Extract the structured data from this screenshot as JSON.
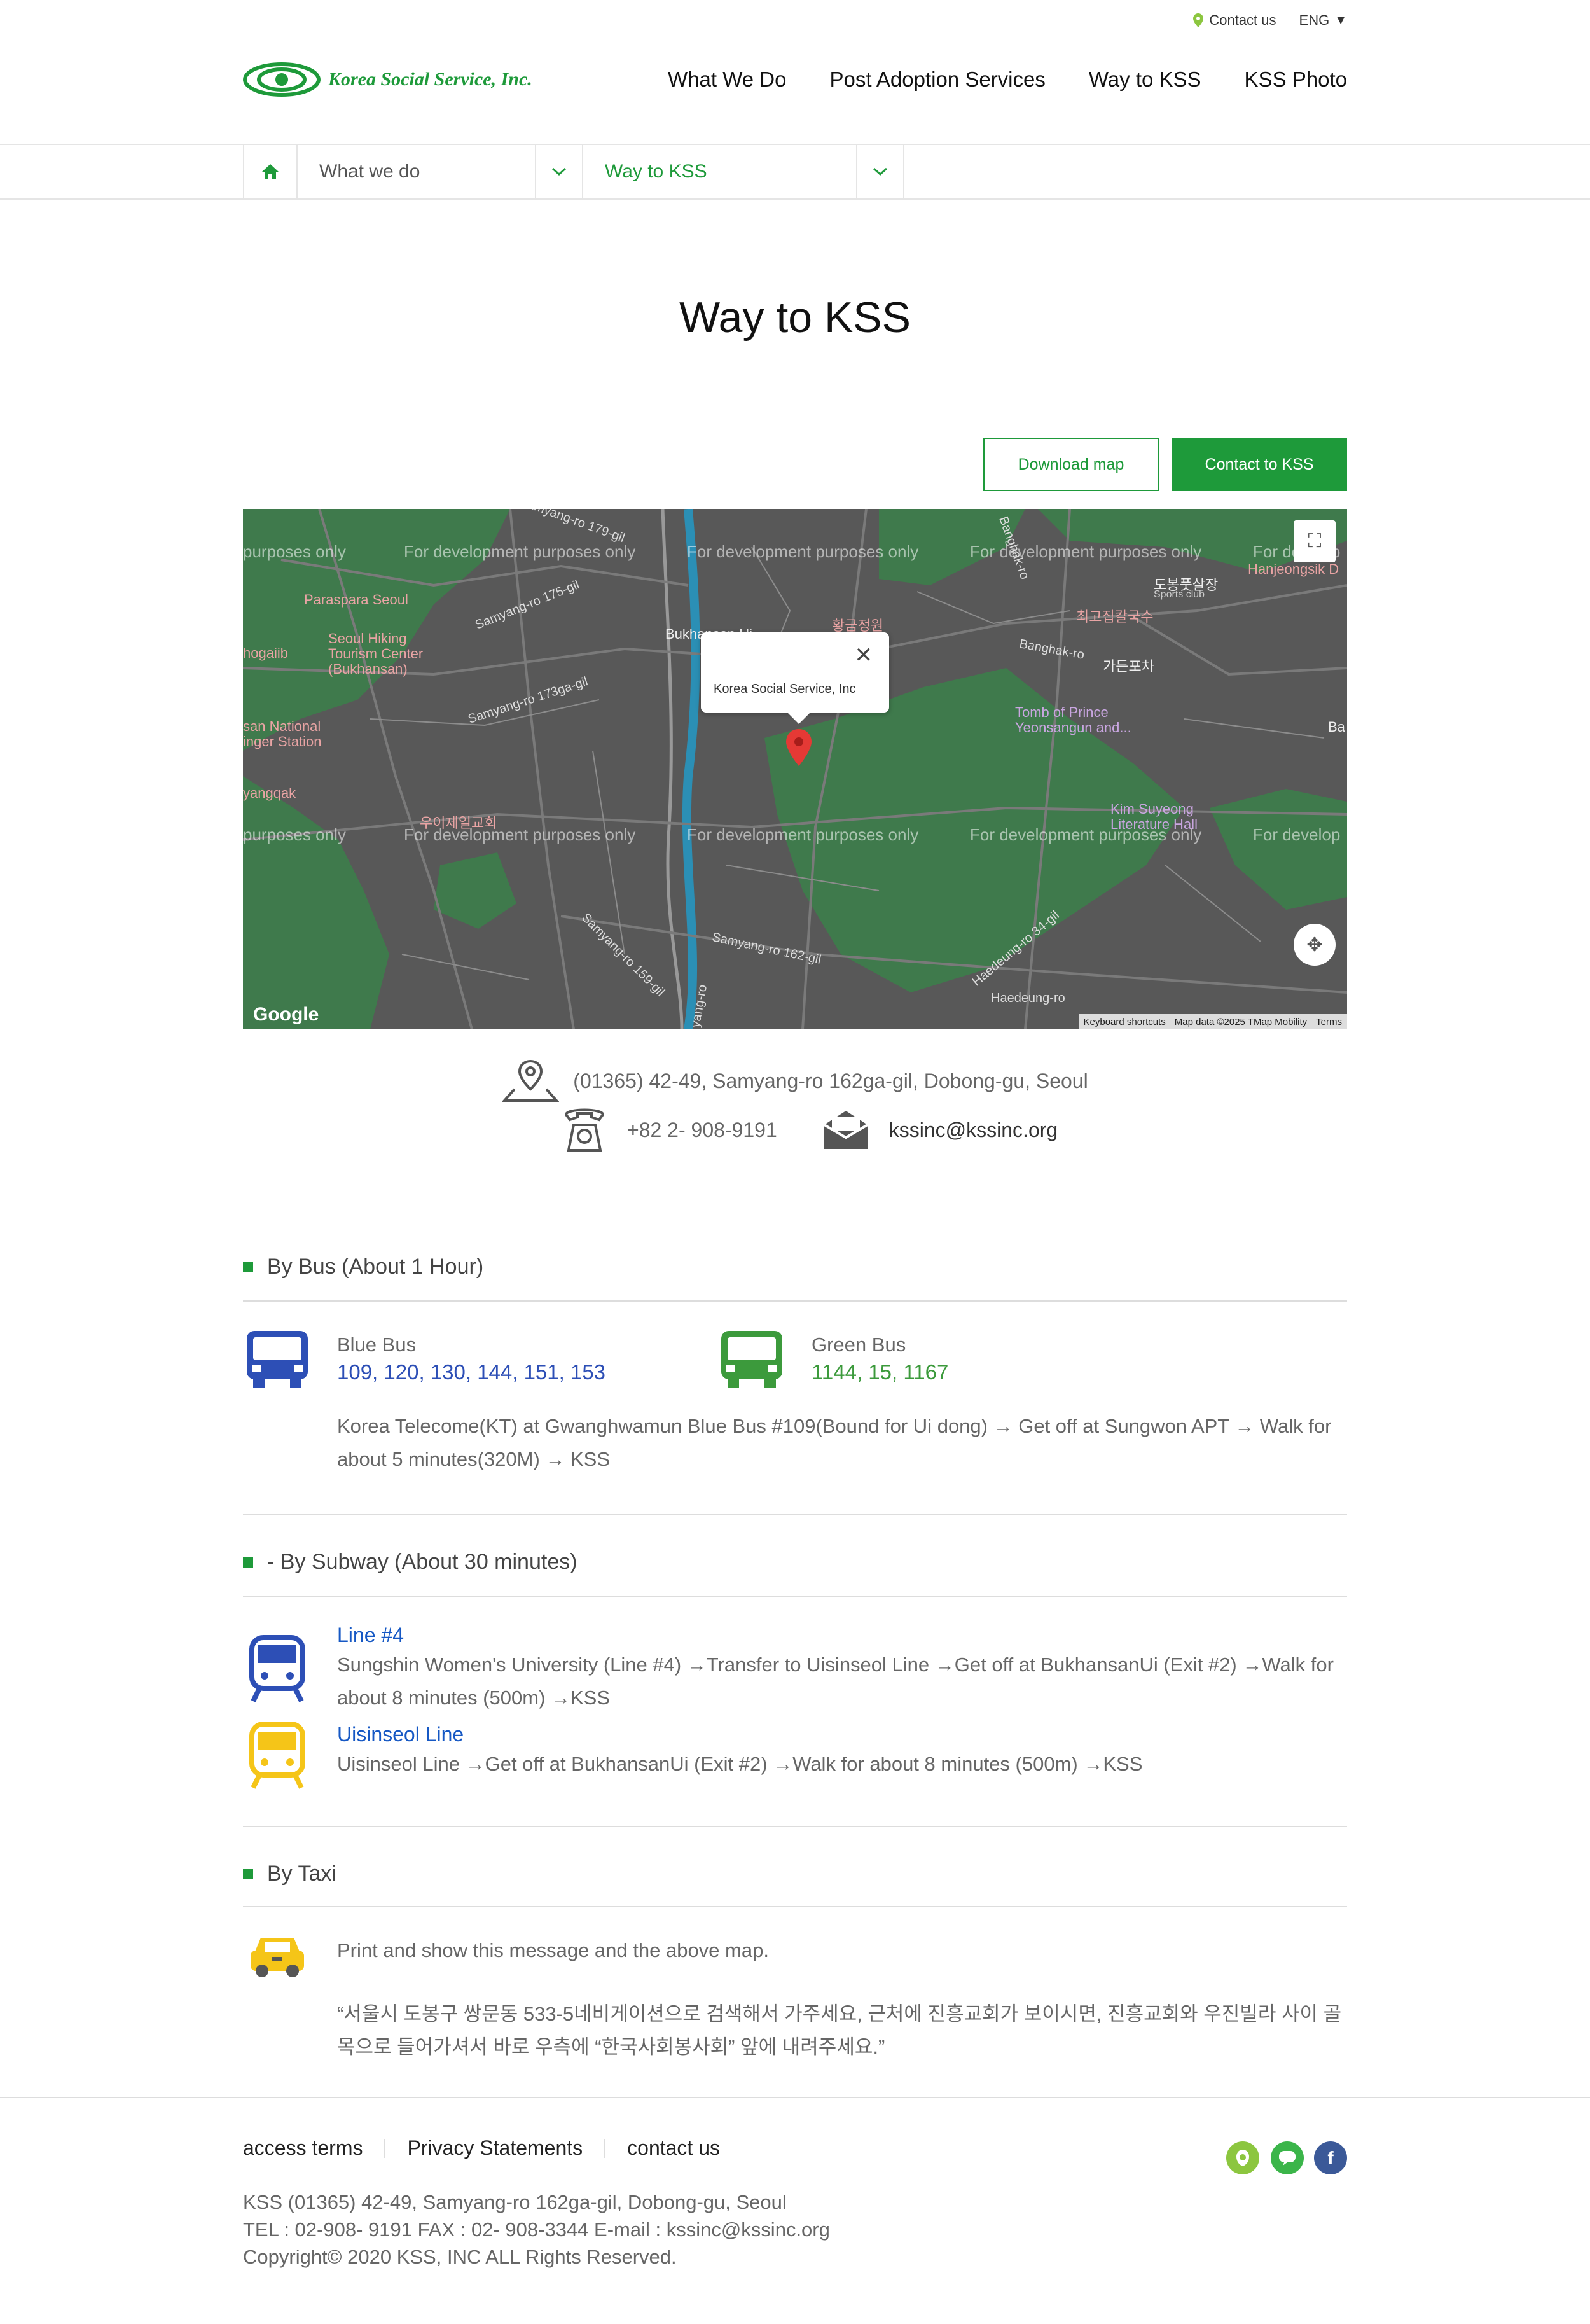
{
  "topbar": {
    "contact": "Contact us",
    "lang": "ENG"
  },
  "header": {
    "logo_text": "Korea Social Service, Inc.",
    "nav": [
      "What We Do",
      "Post Adoption Services",
      "Way to KSS",
      "KSS Photo"
    ]
  },
  "breadcrumb": {
    "level1": "What we do",
    "level2": "Way to KSS"
  },
  "page_title": "Way to KSS",
  "buttons": {
    "download": "Download map",
    "contact": "Contact to KSS"
  },
  "map": {
    "popup_text": "Korea Social Service, Inc",
    "dev_text": "For development purposes only",
    "dev_text_short": "purposes only",
    "dev_text_edge": "For develop",
    "places": {
      "paraspara": "Paraspara Seoul",
      "hiking": "Seoul Hiking Tourism Center (Bukhansan)",
      "hogaiib": "hogaiib",
      "national": "san National inger Station",
      "yangqak": "yangqak",
      "church": "우이제일교회",
      "hwangum": "황금정원",
      "choigo": "최고집칼국수",
      "dobong": "도봉풋살장",
      "sports": "Sports club",
      "garden": "가든포차",
      "tomb": "Tomb of Prince Yeonsangun and...",
      "kim": "Kim Suyeong Literature Hall",
      "hanjeong": "Hanjeongsik D",
      "bukhan": "Bukhansan Ui",
      "ba": "Ba"
    },
    "roads": {
      "r179": "Samyang-ro 179-gil",
      "r175": "Samyang-ro 175-gil",
      "r173": "Samyang-ro 173ga-gil",
      "r159": "Samyang-ro 159-gil",
      "r162": "Samyang-ro 162-gil",
      "banghak": "Banghak-ro",
      "banghak2": "Banghak-ro",
      "haedeung": "Haedeung-ro",
      "haedeung34": "Haedeung-ro 34-gil",
      "yangro": "yang-ro"
    },
    "logo": "Google",
    "attribution": [
      "Keyboard shortcuts",
      "Map data ©2025 TMap Mobility",
      "Terms"
    ]
  },
  "contact": {
    "address": "(01365) 42-49, Samyang-ro 162ga-gil, Dobong-gu, Seoul",
    "phone": "+82 2- 908-9191",
    "email": "kssinc@kssinc.org"
  },
  "bus": {
    "title": "By Bus (About 1 Hour)",
    "blue_label": "Blue Bus",
    "blue_numbers": "109, 120, 130, 144, 151, 153",
    "green_label": "Green Bus",
    "green_numbers": "1144, 15, 1167",
    "route": "Korea Telecome(KT) at Gwanghwamun Blue Bus #109(Bound for Ui dong) → Get off at Sungwon APT → Walk for about 5 minutes(320M) → KSS"
  },
  "subway": {
    "title": "- By Subway (About 30 minutes)",
    "line4_title": "Line #4",
    "line4_text": "Sungshin Women's University (Line #4) →Transfer to Uisinseol Line →Get off at BukhansanUi (Exit #2) →Walk for about 8 minutes (500m) →KSS",
    "uisinseol_title": "Uisinseol Line",
    "uisinseol_text": "Uisinseol Line →Get off at BukhansanUi (Exit #2) →Walk for about 8 minutes (500m) →KSS"
  },
  "taxi": {
    "title": "By Taxi",
    "intro": "Print and show this message and the above map.",
    "message": "“서울시 도봉구 쌍문동 533-5네비게이션으로 검색해서 가주세요, 근처에 진흥교회가 보이시면, 진흥교회와 우진빌라 사이 골목으로 들어가셔서 바로 우측에 “한국사회봉사회” 앞에 내려주세요.”"
  },
  "footer": {
    "links": [
      "access terms",
      "Privacy Statements",
      "contact us"
    ],
    "address": "KSS (01365) 42-49, Samyang-ro 162ga-gil, Dobong-gu, Seoul",
    "contact": "TEL : 02-908- 9191 FAX : 02- 908-3344 E-mail : kssinc@kssinc.org",
    "copyright": "Copyright© 2020 KSS, INC ALL Rights Reserved."
  },
  "colors": {
    "brand_green": "#1e9a3a",
    "blue_bus": "#2d4fb6",
    "green_bus": "#3c9a3c",
    "taxi_yellow": "#f5c518",
    "link_blue": "#1658c4"
  }
}
